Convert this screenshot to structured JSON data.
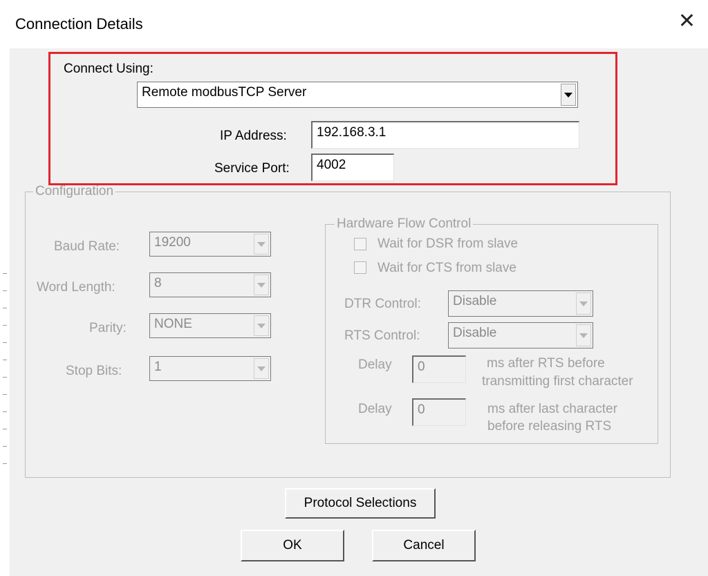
{
  "window": {
    "title": "Connection Details",
    "close_symbol": "✕"
  },
  "connect": {
    "label": "Connect Using:",
    "selected": "Remote modbusTCP Server",
    "ip_label": "IP Address:",
    "ip_value": "192.168.3.1",
    "port_label": "Service Port:",
    "port_value": "4002"
  },
  "configuration": {
    "title": "Configuration",
    "baud_label": "Baud Rate:",
    "baud_value": "19200",
    "word_label": "Word Length:",
    "word_value": "8",
    "parity_label": "Parity:",
    "parity_value": "NONE",
    "stop_label": "Stop Bits:",
    "stop_value": "1"
  },
  "flow": {
    "title": "Hardware Flow Control",
    "dsr_label": "Wait for DSR from slave",
    "cts_label": "Wait for CTS from slave",
    "dtr_label": "DTR Control:",
    "dtr_value": "Disable",
    "rts_label": "RTS Control:",
    "rts_value": "Disable",
    "delay1_label": "Delay",
    "delay1_value": "0",
    "delay1_text_1": "ms after RTS before",
    "delay1_text_2": "transmitting first character",
    "delay2_label": "Delay",
    "delay2_value": "0",
    "delay2_text_1": "ms after last character",
    "delay2_text_2": "before releasing RTS"
  },
  "buttons": {
    "protocol": "Protocol Selections",
    "ok": "OK",
    "cancel": "Cancel"
  },
  "colors": {
    "highlight": "#e0262f",
    "disabled_text": "#a0a0a0"
  }
}
